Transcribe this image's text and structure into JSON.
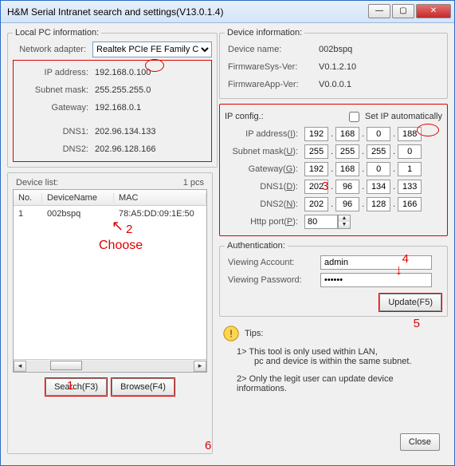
{
  "window": {
    "title": "H&M Serial Intranet search and settings(V13.0.1.4)"
  },
  "local": {
    "legend": "Local PC information:",
    "adapter_label": "Network adapter:",
    "adapter_value": "Realtek PCIe FE Family Cor",
    "ip_label": "IP address:",
    "ip_value": "192.168.0.100",
    "mask_label": "Subnet mask:",
    "mask_value": "255.255.255.0",
    "gw_label": "Gateway:",
    "gw_value": "192.168.0.1",
    "dns1_label": "DNS1:",
    "dns1_value": "202.96.134.133",
    "dns2_label": "DNS2:",
    "dns2_value": "202.96.128.166"
  },
  "devlist": {
    "legend": "Device list:",
    "count": "1 pcs",
    "cols": {
      "no": "No.",
      "name": "DeviceName",
      "mac": "MAC"
    },
    "rows": [
      {
        "no": "1",
        "name": "002bspq",
        "mac": "78:A5:DD:09:1E:50"
      }
    ]
  },
  "buttons": {
    "search": "Search(F3)",
    "browse": "Browse(F4)",
    "update": "Update(F5)",
    "close": "Close"
  },
  "devinfo": {
    "legend": "Device information:",
    "name_label": "Device name:",
    "name_value": "002bspq",
    "fwsys_label": "FirmwareSys-Ver:",
    "fwsys_value": "V0.1.2.10",
    "fwapp_label": "FirmwareApp-Ver:",
    "fwapp_value": "V0.0.0.1"
  },
  "ipcfg": {
    "legend": "IP config.:",
    "auto_label": "Set IP automatically",
    "ip_label": "IP address(I):",
    "ip": [
      "192",
      "168",
      "0",
      "188"
    ],
    "mask_label": "Subnet mask(U):",
    "mask": [
      "255",
      "255",
      "255",
      "0"
    ],
    "gw_label": "Gateway(G):",
    "gw": [
      "192",
      "168",
      "0",
      "1"
    ],
    "dns1_label": "DNS1(D):",
    "dns1": [
      "202",
      "96",
      "134",
      "133"
    ],
    "dns2_label": "DNS2(N):",
    "dns2": [
      "202",
      "96",
      "128",
      "166"
    ],
    "port_label": "Http port(P):",
    "port": "80"
  },
  "auth": {
    "legend": "Authentication:",
    "user_label": "Viewing Account:",
    "user_value": "admin",
    "pass_label": "Viewing Password:",
    "pass_value": "••••••"
  },
  "tips": {
    "head": "Tips:",
    "t1": "1> This tool is only used within LAN,",
    "t1b": "pc and device is within the same subnet.",
    "t2": "2> Only the legit user can update  device informations."
  },
  "ann": {
    "a1": "1",
    "a2": "2",
    "choose": "Choose",
    "a3": "3",
    "a4": "4",
    "a5": "5",
    "a6": "6"
  }
}
